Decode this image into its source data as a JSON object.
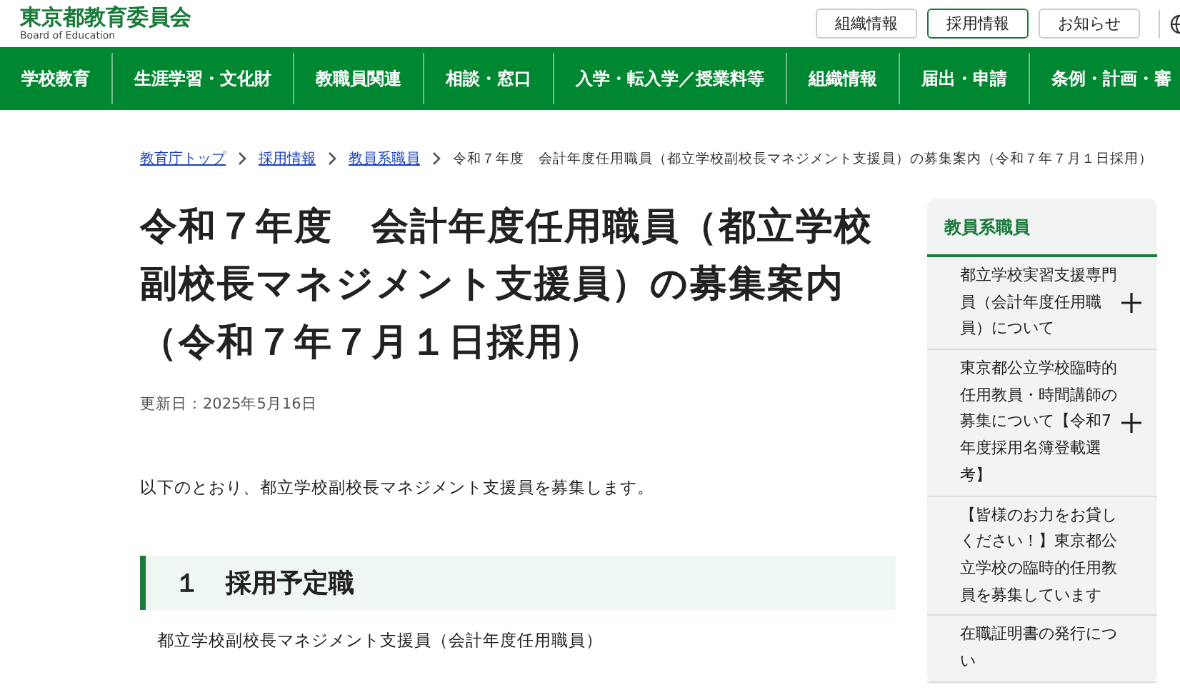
{
  "header": {
    "logo": "東京都教育委員会",
    "logo_sub": "Board of Education",
    "buttons": [
      {
        "label": "組織情報",
        "selected": false
      },
      {
        "label": "採用情報",
        "selected": true
      },
      {
        "label": "お知らせ",
        "selected": false
      }
    ]
  },
  "nav": [
    "学校教育",
    "生涯学習・文化財",
    "教職員関連",
    "相談・窓口",
    "入学・転入学／授業料等",
    "組織情報",
    "届出・申請",
    "条例・計画・審"
  ],
  "breadcrumb": {
    "links": [
      "教育庁トップ",
      "採用情報",
      "教員系職員"
    ],
    "current": "令和７年度　会計年度任用職員（都立学校副校長マネジメント支援員）の募集案内（令和７年７月１日採用）"
  },
  "title": "令和７年度　会計年度任用職員（都立学校副校長マネジメント支援員）の募集案内（令和７年７月１日採用）",
  "updated": "更新日：2025年5月16日",
  "intro": "以下のとおり、都立学校副校長マネジメント支援員を募集します。",
  "section_heading": "１　採用予定職",
  "section_text": "都立学校副校長マネジメント支援員（会計年度任用職員）",
  "sidebar": {
    "heading": "教員系職員",
    "items": [
      {
        "label": "都立学校実習支援専門員（会計年度任用職員）について",
        "kind": "expandable"
      },
      {
        "label": "東京都公立学校臨時的任用教員・時間講師の募集について【令和7年度採用名簿登載選考】",
        "kind": "expandable"
      },
      {
        "label": "【皆様のお力をお貸しください！】東京都公立学校の臨時的任用教員を募集しています",
        "kind": "link"
      },
      {
        "label": "在職証明書の発行につい",
        "kind": "link"
      }
    ]
  }
}
